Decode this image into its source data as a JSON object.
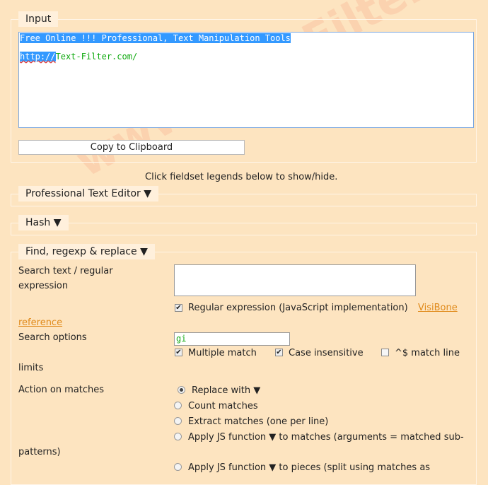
{
  "input": {
    "legend": "Input",
    "line1": "Free Online !!! Professional, Text Manipulation Tools ",
    "line2_selected": "http://",
    "line2_rest": "Text-Filter.com/",
    "copy_button": "Copy to Clipboard"
  },
  "hint": "Click fieldset legends below to show/hide.",
  "sections": {
    "editor": "Professional Text Editor ▼",
    "hash": "Hash ▼",
    "find": "Find, regexp & replace ▼"
  },
  "find": {
    "search_label_1": "Search text / regular",
    "search_label_2": "expression",
    "regex_checkbox": "Regular expression (JavaScript implementation)",
    "visibone": "VisiBone",
    "reference": "reference",
    "options_label": "Search options",
    "options_value": "gi",
    "multiple_match": "Multiple match",
    "case_insensitive": "Case insensitive",
    "line_limits_1": "^$ match line",
    "line_limits_2": "limits",
    "action_label": "Action on matches",
    "replace_with": "Replace with ▼",
    "count_matches": "Count matches",
    "extract_matches": "Extract matches (one per line)",
    "apply_js_1a": "Apply JS function ▼ to matches (arguments = matched sub-",
    "apply_js_1b": "patterns)",
    "apply_js_2": "Apply JS function ▼ to pieces (split using matches as"
  },
  "watermark": "www.Text-Filter.com",
  "colors": {
    "background": "#fde4c0",
    "link": "#e08a1a",
    "selection": "#3399ff",
    "input_text": "#1a1"
  }
}
